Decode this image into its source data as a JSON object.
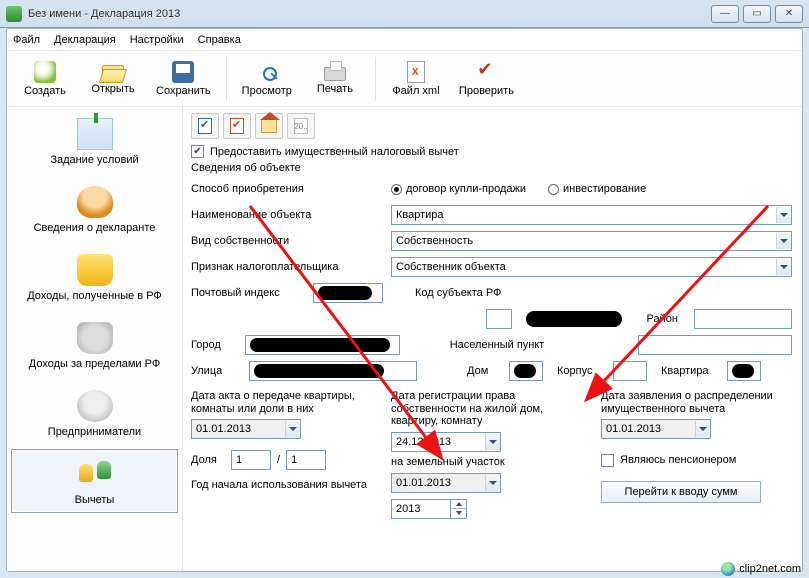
{
  "window": {
    "title": "Без имени - Декларация 2013"
  },
  "menu": {
    "file": "Файл",
    "decl": "Декларация",
    "settings": "Настройки",
    "help": "Справка"
  },
  "toolbar": {
    "new": "Создать",
    "open": "Открыть",
    "save": "Сохранить",
    "preview": "Просмотр",
    "print": "Печать",
    "xml": "Файл xml",
    "check": "Проверить"
  },
  "sidebar": {
    "items": [
      {
        "label": "Задание условий"
      },
      {
        "label": "Сведения о декларанте"
      },
      {
        "label": "Доходы, полученные в РФ"
      },
      {
        "label": "Доходы за пределами РФ"
      },
      {
        "label": "Предприниматели"
      },
      {
        "label": "Вычеты"
      }
    ],
    "active_index": 5
  },
  "mini_toolbar": {
    "num": "20.."
  },
  "form": {
    "provide_deduction_checked": true,
    "provide_deduction_label": "Предоставить имущественный налоговый вычет",
    "group_title": "Сведения об объекте",
    "acq_method_label": "Способ приобретения",
    "acq_method_options": {
      "purchase": "договор купли-продажи",
      "invest": "инвестирование",
      "selected": "purchase"
    },
    "obj_name_label": "Наименование объекта",
    "obj_name_value": "Квартира",
    "own_type_label": "Вид собственности",
    "own_type_value": "Собственность",
    "taxpayer_sign_label": "Признак налогоплательщика",
    "taxpayer_sign_value": "Собственник объекта",
    "postal_label": "Почтовый индекс",
    "subject_label": "Код субъекта РФ",
    "district_label": "Район",
    "city_label": "Город",
    "locality_label": "Населенный пункт",
    "street_label": "Улица",
    "house_label": "Дом",
    "korpus_label": "Корпус",
    "flat_label": "Квартира",
    "date_act_label": "Дата акта о передаче квартиры, комнаты или доли в них",
    "date_act_value": "01.01.2013",
    "date_reg_label": "Дата регистрации права собственности на жилой дом, квартиру, комнату",
    "date_reg_value": "24.12.2013",
    "date_land_label": "на земельный участок",
    "date_land_value": "01.01.2013",
    "date_appl_label": "Дата заявления о распределении имущественного вычета",
    "date_appl_value": "01.01.2013",
    "share_label": "Доля",
    "share_num": "1",
    "share_den": "1",
    "pensioner_label": "Являюсь пенсионером",
    "pensioner_checked": false,
    "year_start_label": "Год начала использования вычета",
    "year_start_value": "2013",
    "go_sums_label": "Перейти к вводу сумм"
  },
  "watermark": "clip2net.com"
}
